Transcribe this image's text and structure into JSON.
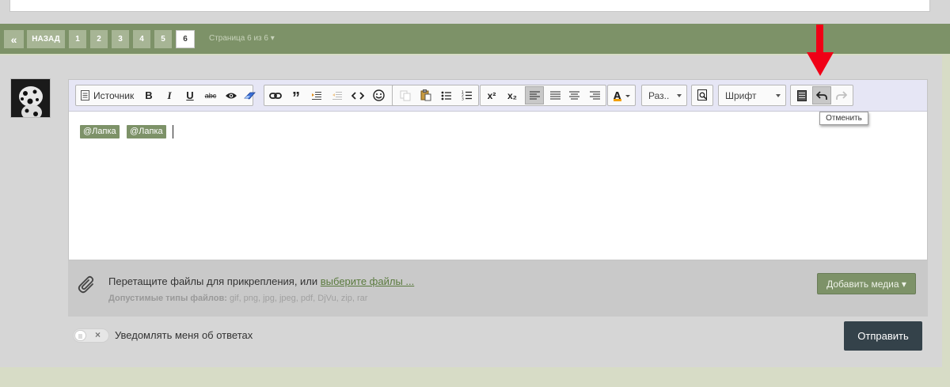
{
  "pagination": {
    "first_icon": "«",
    "back_label": "НАЗАД",
    "pages": [
      "1",
      "2",
      "3",
      "4",
      "5",
      "6"
    ],
    "current_page": "6",
    "info": "Страница 6 из 6 ▾"
  },
  "toolbar": {
    "source_label": "Источник",
    "bold": "B",
    "italic": "I",
    "underline": "U",
    "strike": "abc",
    "superscript": "x²",
    "subscript": "x₂",
    "size_label": "Раз..",
    "font_label": "Шрифт"
  },
  "editor": {
    "mentions": [
      "@Лапка",
      "@Лапка"
    ]
  },
  "tooltip": "Отменить",
  "attach": {
    "text": "Перетащите файлы для прикрепления, или ",
    "link": "выберите файлы ...",
    "types_label": "Допустимые типы файлов:",
    "types": "gif, png, jpg, jpeg, pdf, DjVu, zip, rar",
    "media_button": "Добавить медиа ▾"
  },
  "notify_label": "Уведомлять меня об ответах",
  "send_button": "Отправить",
  "colors": {
    "accent_green": "#7d9268",
    "send_dark": "#34424a",
    "arrow_red": "#f00016"
  }
}
